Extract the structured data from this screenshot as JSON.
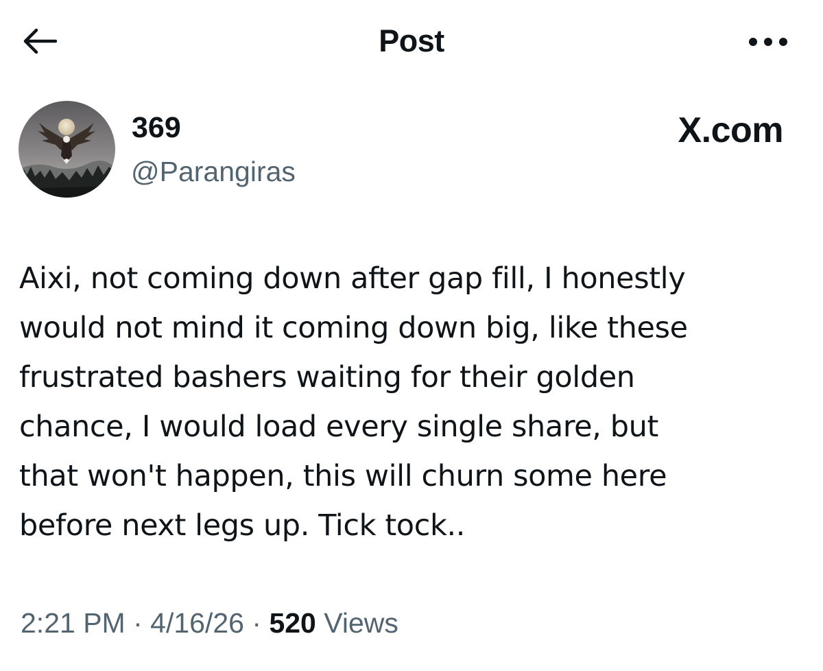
{
  "header": {
    "title": "Post",
    "back_icon": "back-arrow-icon",
    "more_icon": "more-horizontal-icon"
  },
  "author": {
    "display_name": "369",
    "handle": "@Parangiras",
    "avatar_description": "eagle-moon-avatar"
  },
  "source_label": "X.com",
  "post": {
    "lines": [
      "Aixi, not coming down after gap fill, I honestly",
      "would not mind it coming down big, like these",
      "frustrated bashers waiting for their golden",
      "chance, I would load every single share, but",
      "that won't happen, this will churn some here",
      "before next legs up. Tick tock.."
    ]
  },
  "meta": {
    "time": "2:21 PM",
    "separator": "·",
    "date": "4/16/26",
    "views_count": "520",
    "views_label": "Views"
  },
  "colors": {
    "text_primary": "#0f1419",
    "text_secondary": "#536471",
    "background": "#ffffff"
  }
}
